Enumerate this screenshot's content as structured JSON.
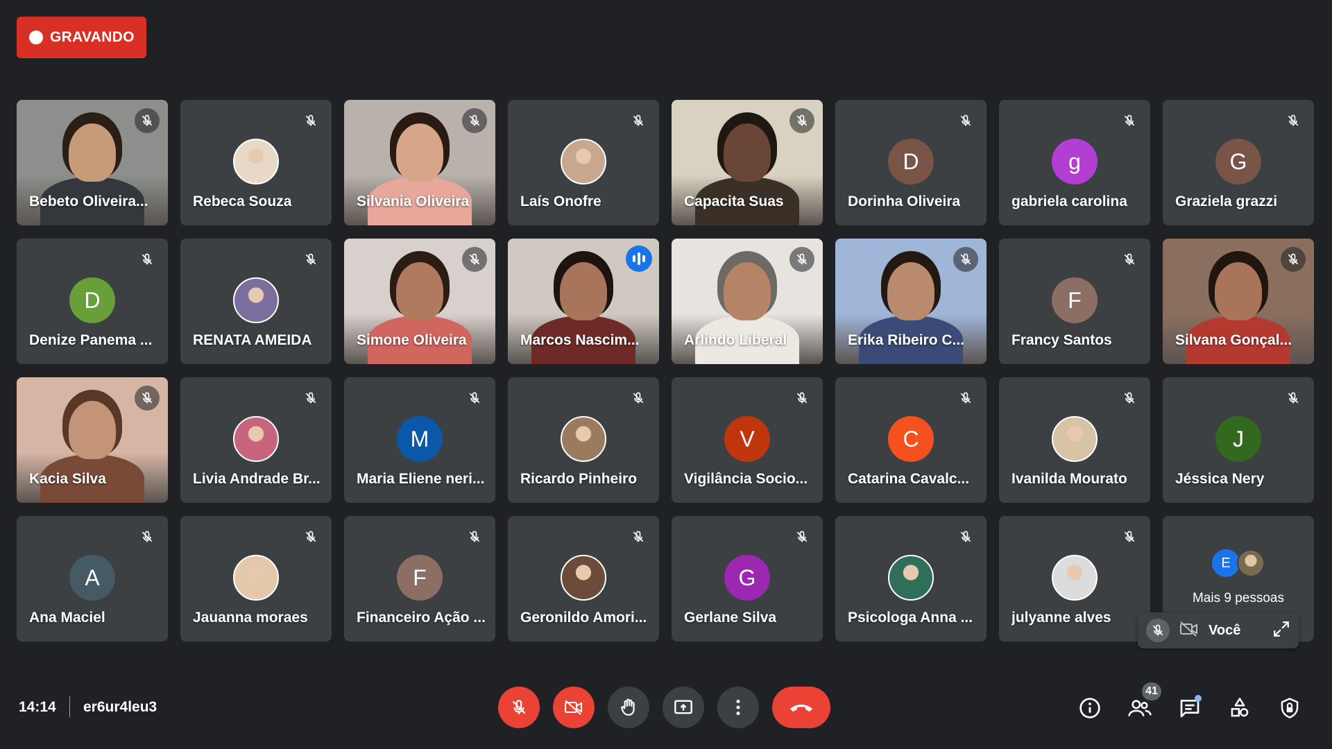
{
  "recording": {
    "label": "GRAVANDO",
    "color": "#d93025"
  },
  "tiles": [
    {
      "name": "Bebeto Oliveira...",
      "kind": "video",
      "bg": "#8c8f8c",
      "skin": "#c79a7a",
      "hair": "#2a1e16",
      "shirt": "#34383c"
    },
    {
      "name": "Rebeca Souza",
      "kind": "photo",
      "avatar_color": "#e8d8c8"
    },
    {
      "name": "Silvania Oliveira",
      "kind": "video",
      "bg": "#b9b2ac",
      "skin": "#d6a58a",
      "hair": "#2a1b12",
      "shirt": "#e7a89b"
    },
    {
      "name": "Laís Onofre",
      "kind": "photo",
      "avatar_color": "#c9a78e"
    },
    {
      "name": "Capacita Suas",
      "kind": "video",
      "bg": "#d9d2c2",
      "skin": "#6a4636",
      "hair": "#1e1712",
      "shirt": "#3a3028"
    },
    {
      "name": "Dorinha Oliveira",
      "kind": "letter",
      "letter": "D",
      "avatar_color": "#795548"
    },
    {
      "name": "gabriela carolina",
      "kind": "letter",
      "letter": "g",
      "avatar_color": "#b23fd1"
    },
    {
      "name": "Graziela grazzi",
      "kind": "letter",
      "letter": "G",
      "avatar_color": "#795548"
    },
    {
      "name": "Denize Panema ...",
      "kind": "letter",
      "letter": "D",
      "avatar_color": "#689f38"
    },
    {
      "name": "RENATA AMEIDA",
      "kind": "photo",
      "avatar_color": "#7b6e9e"
    },
    {
      "name": "Simone Oliveira",
      "kind": "video",
      "bg": "#d8d0cc",
      "skin": "#b07a5e",
      "hair": "#2b1c14",
      "shirt": "#d1665e"
    },
    {
      "name": "Marcos Nascim...",
      "kind": "video",
      "speaking": true,
      "bg": "#cfc9c2",
      "skin": "#a8745a",
      "hair": "#1b1410",
      "shirt": "#6e2a27"
    },
    {
      "name": "Arlindo Liberal",
      "kind": "video",
      "bg": "#e7e4df",
      "skin": "#b58366",
      "hair": "#6d6a66",
      "shirt": "#ece9e2"
    },
    {
      "name": "Erika Ribeiro C...",
      "kind": "video",
      "bg": "#9fb6d8",
      "skin": "#b98a6e",
      "hair": "#231812",
      "shirt": "#3a4b78"
    },
    {
      "name": "Francy Santos",
      "kind": "letter",
      "letter": "F",
      "avatar_color": "#8d6e63"
    },
    {
      "name": "Silvana Gonçal...",
      "kind": "video",
      "bg": "#8a6f5f",
      "skin": "#a8745a",
      "hair": "#20160f",
      "shirt": "#b43a30"
    },
    {
      "name": "Kacia Silva",
      "kind": "video",
      "bg": "#d6b5a5",
      "skin": "#c49478",
      "hair": "#5a3828",
      "shirt": "#7a4a38"
    },
    {
      "name": "Livia Andrade Br...",
      "kind": "photo",
      "avatar_color": "#c8647e"
    },
    {
      "name": "Maria Eliene neri...",
      "kind": "letter",
      "letter": "M",
      "avatar_color": "#0b57a8"
    },
    {
      "name": "Ricardo Pinheiro",
      "kind": "photo",
      "avatar_color": "#9b7b5e"
    },
    {
      "name": "Vigilância Socio...",
      "kind": "letter",
      "letter": "V",
      "avatar_color": "#c0360c"
    },
    {
      "name": "Catarina Cavalc...",
      "kind": "letter",
      "letter": "C",
      "avatar_color": "#f4511e"
    },
    {
      "name": "Ivanilda Mourato",
      "kind": "photo",
      "avatar_color": "#d7c4a6"
    },
    {
      "name": "Jéssica Nery",
      "kind": "letter",
      "letter": "J",
      "avatar_color": "#33691e"
    },
    {
      "name": "Ana Maciel",
      "kind": "letter",
      "letter": "A",
      "avatar_color": "#455a64"
    },
    {
      "name": "Jauanna moraes",
      "kind": "photo",
      "avatar_color": "#e3c9a9"
    },
    {
      "name": "Financeiro Ação ...",
      "kind": "letter",
      "letter": "F",
      "avatar_color": "#8d6e63"
    },
    {
      "name": "Geronildo Amori...",
      "kind": "photo",
      "avatar_color": "#6b4b3a"
    },
    {
      "name": "Gerlane Silva",
      "kind": "letter",
      "letter": "G",
      "avatar_color": "#9c27b0"
    },
    {
      "name": "Psicologa Anna ...",
      "kind": "photo",
      "avatar_color": "#2f6f5a"
    },
    {
      "name": "julyanne alves",
      "kind": "photo",
      "avatar_color": "#dcdcdc"
    }
  ],
  "more_tile": {
    "label": "Mais 9 pessoas",
    "letter": "E",
    "letter_color": "#1a73e8"
  },
  "self_view": {
    "name": "Você"
  },
  "footer": {
    "time": "14:14",
    "meeting_code": "er6ur4leu3",
    "participant_count": "41"
  },
  "icons": {
    "controls": [
      "mic-off-icon",
      "camera-off-icon",
      "raise-hand-icon",
      "present-screen-icon",
      "more-options-icon",
      "end-call-icon"
    ],
    "right": [
      "info-icon",
      "people-icon",
      "chat-icon",
      "activities-icon",
      "host-controls-icon"
    ]
  }
}
